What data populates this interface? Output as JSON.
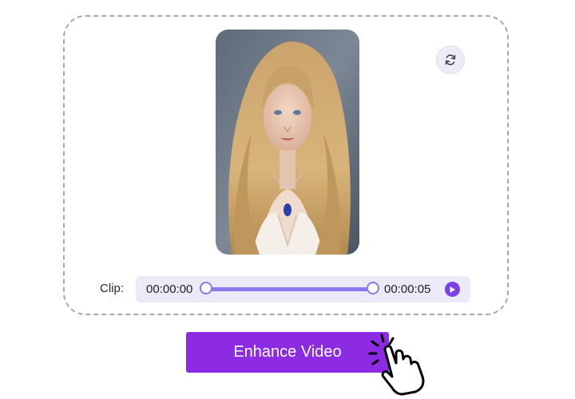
{
  "clip": {
    "label": "Clip:",
    "start_time": "00:00:00",
    "end_time": "00:00:05",
    "range_start_fraction": 0,
    "range_end_fraction": 1
  },
  "actions": {
    "enhance_label": "Enhance Video"
  },
  "icons": {
    "replace": "refresh-icon",
    "play": "play-icon",
    "cursor": "pointing-hand-icon"
  },
  "colors": {
    "accent": "#8d2be4",
    "slider": "#8a78ec",
    "play": "#7b40e8",
    "clip_bar": "#eceaf9",
    "dashed_border": "#a9a9a9"
  }
}
